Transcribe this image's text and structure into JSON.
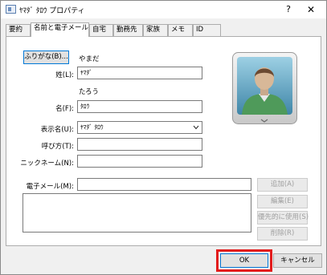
{
  "window": {
    "title": "ﾔﾏﾀﾞ ﾀﾛｳ プロパティ",
    "help_label": "?",
    "close_label": "✕"
  },
  "tabs": [
    {
      "label": "要約"
    },
    {
      "label": "名前と電子メール",
      "active": true
    },
    {
      "label": "自宅"
    },
    {
      "label": "勤務先"
    },
    {
      "label": "家族"
    },
    {
      "label": "メモ"
    },
    {
      "label": "ID"
    }
  ],
  "name_section": {
    "furigana_button": "ふりがな(B)...",
    "last_name_reading": "やまだ",
    "last_name_label": "姓(L):",
    "last_name_value": "ﾔﾏﾀﾞ",
    "first_name_reading": "たろう",
    "first_name_label": "名(F):",
    "first_name_value": "ﾀﾛｳ",
    "display_name_label": "表示名(U):",
    "display_name_value": "ﾔﾏﾀﾞ ﾀﾛｳ",
    "call_name_label": "呼び方(T):",
    "call_name_value": "",
    "nickname_label": "ニックネーム(N):",
    "nickname_value": ""
  },
  "email_section": {
    "email_label": "電子メール(M):",
    "email_value": "",
    "add_button": "追加(A)",
    "edit_button": "編集(E)",
    "default_button": "優先的に使用(S)",
    "delete_button": "削除(R)"
  },
  "footer": {
    "ok_label": "OK",
    "cancel_label": "キャンセル"
  },
  "colors": {
    "highlight": "#e31c1c",
    "avatar_bg": "#6aa8c4",
    "avatar_shirt": "#4f9a5a"
  },
  "icons": {
    "title": "contact-card-icon",
    "dropdown": "chevron-down-icon",
    "avatar": "person-icon"
  }
}
